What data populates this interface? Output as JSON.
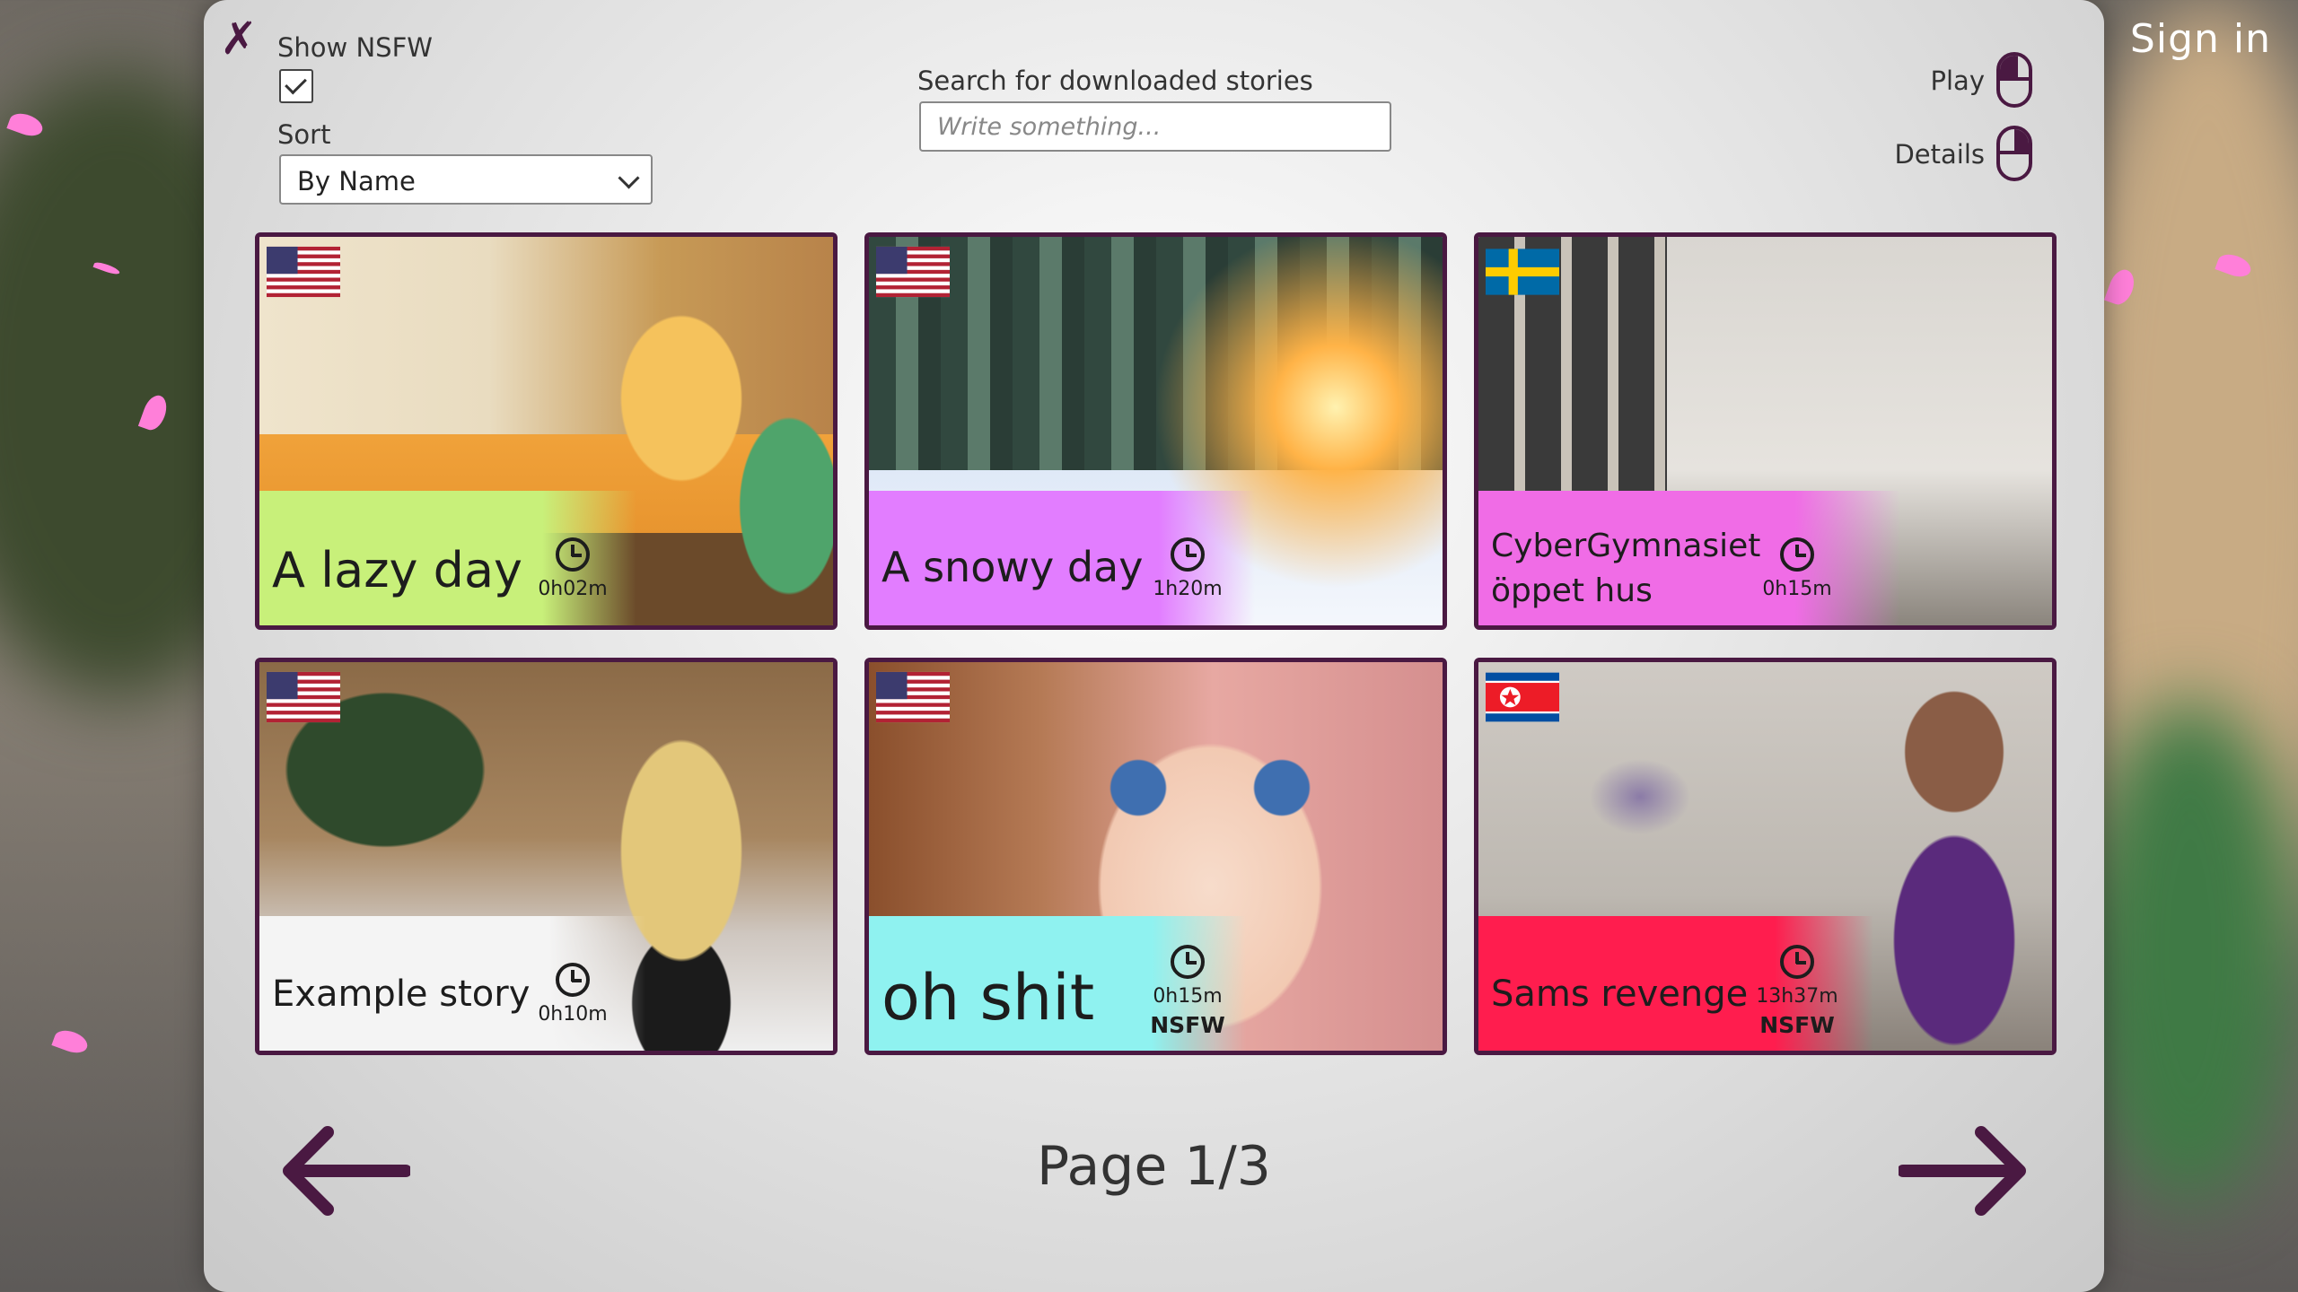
{
  "header": {
    "sign_in": "Sign in"
  },
  "controls": {
    "show_nsfw_label": "Show NSFW",
    "show_nsfw_checked": true,
    "sort_label": "Sort",
    "sort_value": "By Name",
    "search_label": "Search for downloaded stories",
    "search_placeholder": "Write something...",
    "play_label": "Play",
    "details_label": "Details"
  },
  "stories": [
    {
      "title": "A lazy day",
      "duration": "0h02m",
      "nsfw": "",
      "flag": "us",
      "band_color": "#c8f07a"
    },
    {
      "title": "A snowy day",
      "duration": "1h20m",
      "nsfw": "",
      "flag": "us",
      "band_color": "#e27dff"
    },
    {
      "title_line1": "CyberGymnasiet",
      "title_line2": "öppet hus",
      "duration": "0h15m",
      "nsfw": "",
      "flag": "se",
      "band_color": "#f06ce6"
    },
    {
      "title": "Example story",
      "duration": "0h10m",
      "nsfw": "",
      "flag": "us",
      "band_color": "#f4f4f4"
    },
    {
      "title": "oh shit",
      "duration": "0h15m",
      "nsfw": "NSFW",
      "flag": "us",
      "band_color": "#8ff2f0"
    },
    {
      "title": "Sams revenge",
      "duration": "13h37m",
      "nsfw": "NSFW",
      "flag": "kp",
      "band_color": "#ff1d4e"
    }
  ],
  "pagination": {
    "label": "Page 1/3"
  },
  "colors": {
    "accent": "#4a1942",
    "panel": "#e6e6e6"
  }
}
